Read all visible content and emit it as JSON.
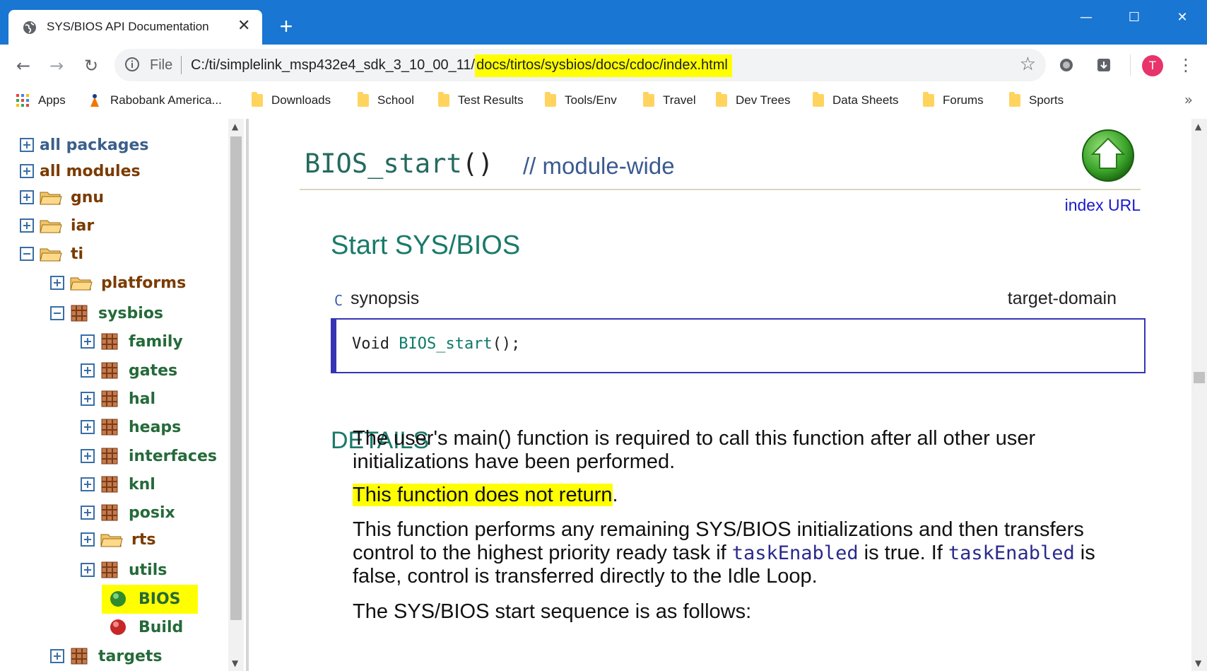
{
  "browser": {
    "tab_title": "SYS/BIOS API Documentation",
    "tab_close": "✕",
    "new_tab": "+",
    "window_controls": {
      "minimize": "—",
      "maximize": "☐",
      "close": "✕"
    },
    "nav": {
      "back": "←",
      "forward": "→",
      "reload": "↻"
    },
    "omnibox": {
      "scheme": "File",
      "url_prefix": "C:/ti/simplelink_msp432e4_sdk_3_10_00_11/",
      "url_highlighted": "docs/tirtos/sysbios/docs/cdoc/index.html"
    },
    "profile_initial": "T",
    "menu": "⋮"
  },
  "bookmarks": {
    "items": [
      {
        "label": "Apps",
        "icon": "apps-grid-icon"
      },
      {
        "label": "Rabobank America...",
        "icon": "rabobank-icon"
      },
      {
        "label": "Downloads",
        "icon": "folder-icon"
      },
      {
        "label": "School",
        "icon": "folder-icon"
      },
      {
        "label": "Test Results",
        "icon": "folder-icon"
      },
      {
        "label": "Tools/Env",
        "icon": "folder-icon"
      },
      {
        "label": "Travel",
        "icon": "folder-icon"
      },
      {
        "label": "Dev Trees",
        "icon": "folder-icon"
      },
      {
        "label": "Data Sheets",
        "icon": "folder-icon"
      },
      {
        "label": "Forums",
        "icon": "folder-icon"
      },
      {
        "label": "Sports",
        "icon": "folder-icon"
      }
    ],
    "more": "»"
  },
  "tree": {
    "all_packages": "all packages",
    "all_modules": "all modules",
    "gnu": "gnu",
    "iar": "iar",
    "ti": "ti",
    "platforms": "platforms",
    "sysbios": "sysbios",
    "family": "family",
    "gates": "gates",
    "hal": "hal",
    "heaps": "heaps",
    "interfaces": "interfaces",
    "knl": "knl",
    "posix": "posix",
    "rts": "rts",
    "utils": "utils",
    "bios": "BIOS",
    "build": "Build",
    "targets": "targets"
  },
  "content": {
    "function_name": "BIOS_start",
    "function_parens": "()",
    "scope": "// module-wide",
    "index_url": "index URL",
    "summary": "Start SYS/BIOS",
    "synopsis_lang": "C",
    "synopsis_label": "synopsis",
    "synopsis_domain": "target-domain",
    "code_type": "Void ",
    "code_fn": "BIOS_start",
    "code_tail": "();",
    "details_heading": "DETAILS",
    "p1": "The user's main() function is required to call this function after all other user initializations have been performed.",
    "p2_highlight": "This function does not return",
    "p2_tail": ".",
    "p3_a": "This function performs any remaining SYS/BIOS initializations and then transfers control to the highest priority ready task if ",
    "p3_code1": "taskEnabled",
    "p3_b": " is true. If ",
    "p3_code2": "taskEnabled",
    "p3_c": " is false, control is transferred directly to the Idle Loop.",
    "p4": "The SYS/BIOS start sequence is as follows:"
  },
  "colors": {
    "titlebar": "#1976d2",
    "highlight": "#ffff00",
    "link": "#1a1acc",
    "teal_heading": "#1a7a6a"
  }
}
